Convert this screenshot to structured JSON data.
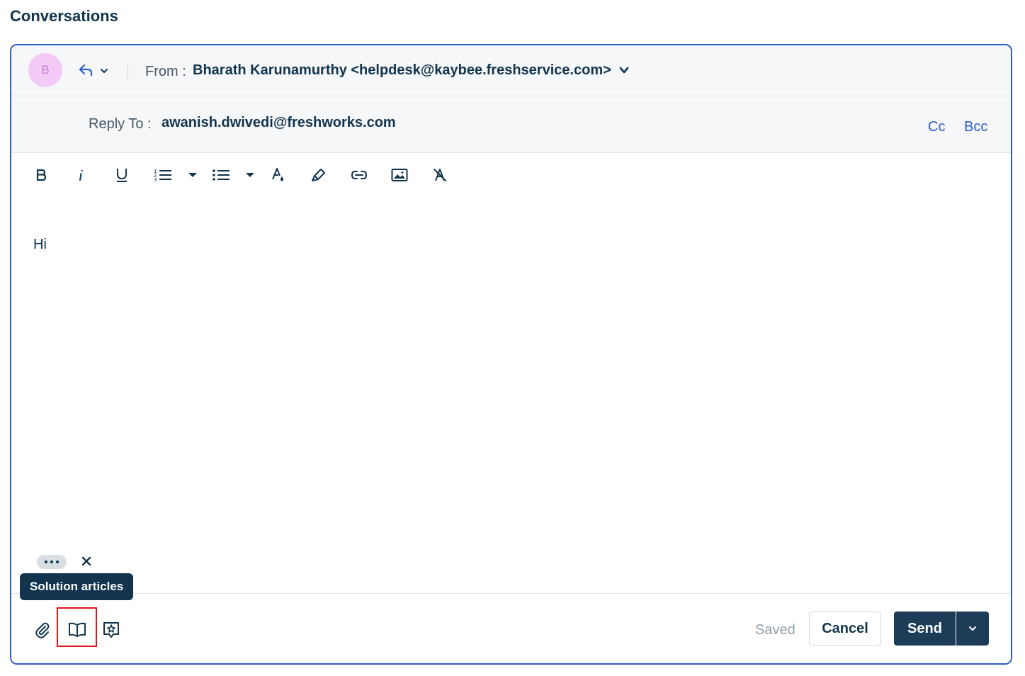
{
  "section": {
    "title": "Conversations"
  },
  "header": {
    "avatar_initial": "B",
    "from_label": "From :",
    "from_value": "Bharath Karunamurthy <helpdesk@kaybee.freshservice.com>"
  },
  "reply_to": {
    "label": "Reply To :",
    "value": "awanish.dwivedi@freshworks.com",
    "cc_label": "Cc",
    "bcc_label": "Bcc"
  },
  "toolbar": {
    "icons": [
      "bold-icon",
      "italic-icon",
      "underline-icon",
      "ordered-list-icon",
      "unordered-list-icon",
      "text-color-icon",
      "highlight-icon",
      "link-icon",
      "image-icon",
      "clear-format-icon"
    ]
  },
  "editor": {
    "body": "Hi"
  },
  "tooltip": {
    "text": "Solution articles"
  },
  "footer": {
    "icons": [
      "attachment-icon",
      "solution-articles-icon",
      "canned-response-icon"
    ],
    "saved_label": "Saved",
    "cancel_label": "Cancel",
    "send_label": "Send"
  },
  "colors": {
    "accent": "#2c5cc5",
    "primary_dark": "#1c3c58",
    "highlight": "#e3141a",
    "avatar_bg": "#f3c9f5"
  }
}
